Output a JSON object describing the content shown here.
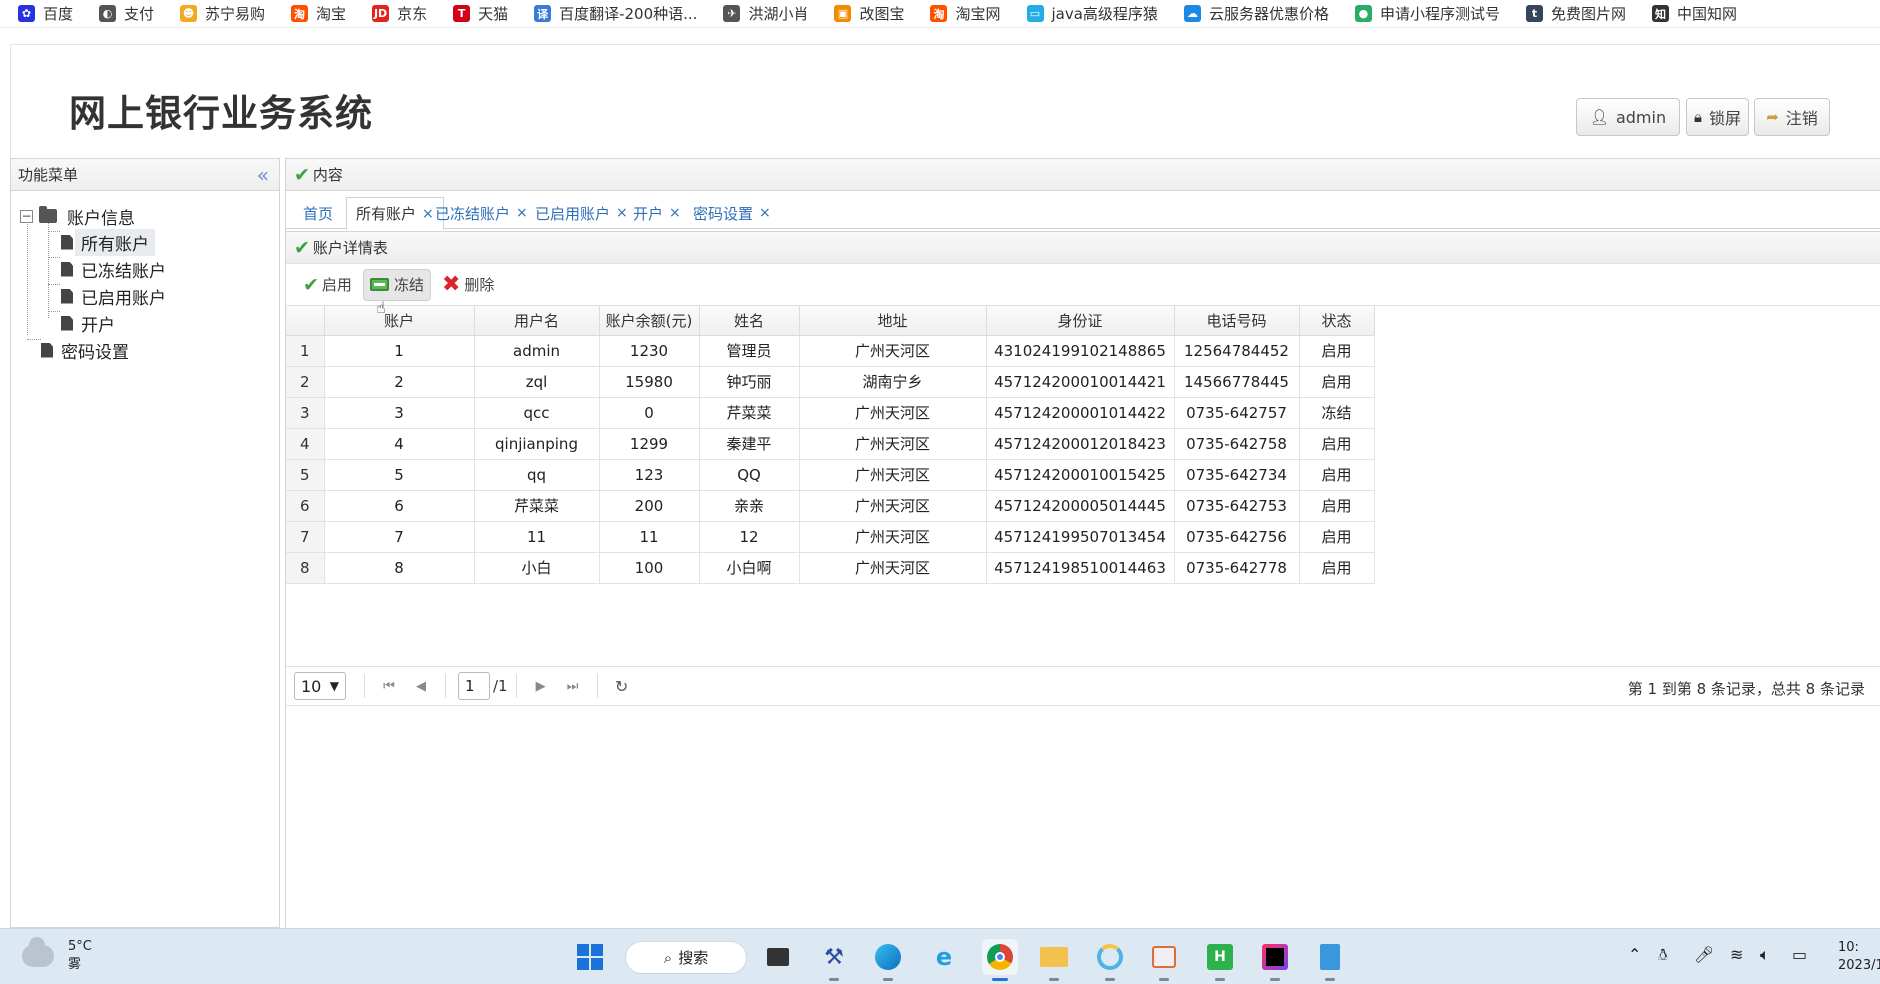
{
  "bookmarks": [
    {
      "label": "百度",
      "icon": "baidu-icon",
      "color": "#2932e1",
      "glyph": "✿"
    },
    {
      "label": "支付",
      "icon": "globe-icon",
      "color": "#555555",
      "glyph": "◐"
    },
    {
      "label": "苏宁易购",
      "icon": "suning-icon",
      "color": "#f5a623",
      "glyph": "☻"
    },
    {
      "label": "淘宝",
      "icon": "taobao-icon",
      "color": "#ff5000",
      "glyph": "淘"
    },
    {
      "label": "京东",
      "icon": "jd-icon",
      "color": "#e1251b",
      "glyph": "JD"
    },
    {
      "label": "天猫",
      "icon": "tmall-icon",
      "color": "#d4001a",
      "glyph": "T"
    },
    {
      "label": "百度翻译-200种语...",
      "icon": "translate-icon",
      "color": "#3a7bd5",
      "glyph": "译"
    },
    {
      "label": "洪湖小肖",
      "icon": "bird-icon",
      "color": "#555555",
      "glyph": "✈"
    },
    {
      "label": "改图宝",
      "icon": "gaitubao-icon",
      "color": "#f08c00",
      "glyph": "▣"
    },
    {
      "label": "淘宝网",
      "icon": "taobao2-icon",
      "color": "#ff5000",
      "glyph": "淘"
    },
    {
      "label": "java高级程序猿",
      "icon": "bilibili-icon",
      "color": "#23ade5",
      "glyph": "▭"
    },
    {
      "label": "云服务器优惠价格",
      "icon": "cloud-icon",
      "color": "#1e88e5",
      "glyph": "☁"
    },
    {
      "label": "申请小程序测试号",
      "icon": "wechat-icon",
      "color": "#2aae67",
      "glyph": "●"
    },
    {
      "label": "免费图片网",
      "icon": "tumblr-icon",
      "color": "#35465c",
      "glyph": "t"
    },
    {
      "label": "中国知网",
      "icon": "cnki-icon",
      "color": "#333333",
      "glyph": "知"
    }
  ],
  "header": {
    "title": "网上银行业务系统",
    "user_label": "admin",
    "lock_label": "锁屏",
    "logout_label": "注销"
  },
  "sidebar": {
    "title": "功能菜单",
    "collapse_glyph": "«",
    "root": {
      "label": "账户信息",
      "expander": "−"
    },
    "children": [
      "所有账户",
      "已冻结账户",
      "已启用账户",
      "开户"
    ],
    "extra": "密码设置"
  },
  "main": {
    "title": "内容",
    "tabs": [
      {
        "label": "首页",
        "closable": false
      },
      {
        "label": "所有账户",
        "closable": true
      },
      {
        "label": "已冻结账户",
        "closable": true
      },
      {
        "label": "已启用账户",
        "closable": true
      },
      {
        "label": "开户",
        "closable": true
      },
      {
        "label": "密码设置",
        "closable": true
      }
    ],
    "close_glyph": "×",
    "grid_title": "账户详情表",
    "toolbar": {
      "enable": "启用",
      "freeze": "冻结",
      "delete": "删除"
    },
    "columns": [
      "账户",
      "用户名",
      "账户余额(元)",
      "姓名",
      "地址",
      "身份证",
      "电话号码",
      "状态"
    ],
    "rows": [
      [
        "1",
        "1",
        "admin",
        "1230",
        "管理员",
        "广州天河区",
        "431024199102148865",
        "12564784452",
        "启用"
      ],
      [
        "2",
        "2",
        "zql",
        "15980",
        "钟巧丽",
        "湖南宁乡",
        "457124200010014421",
        "14566778445",
        "启用"
      ],
      [
        "3",
        "3",
        "qcc",
        "0",
        "芹菜菜",
        "广州天河区",
        "457124200001014422",
        "0735-642757",
        "冻结"
      ],
      [
        "4",
        "4",
        "qinjianping",
        "1299",
        "秦建平",
        "广州天河区",
        "457124200012018423",
        "0735-642758",
        "启用"
      ],
      [
        "5",
        "5",
        "qq",
        "123",
        "QQ",
        "广州天河区",
        "457124200010015425",
        "0735-642734",
        "启用"
      ],
      [
        "6",
        "6",
        "芹菜菜",
        "200",
        "亲亲",
        "广州天河区",
        "457124200005014445",
        "0735-642753",
        "启用"
      ],
      [
        "7",
        "7",
        "11",
        "11",
        "12",
        "广州天河区",
        "457124199507013454",
        "0735-642756",
        "启用"
      ],
      [
        "8",
        "8",
        "小白",
        "100",
        "小白啊",
        "广州天河区",
        "457124198510014463",
        "0735-642778",
        "启用"
      ]
    ],
    "pager": {
      "page_size": "10",
      "page": "1",
      "total_pages": "/1",
      "info": "第 1 到第 8 条记录，总共 8 条记录"
    }
  },
  "taskbar": {
    "temp": "5°C",
    "condition": "雾",
    "search_label": "搜索",
    "clock_time": "10:",
    "clock_date": "2023/1"
  },
  "colors": {
    "accent": "#2d6fb8",
    "enable_green": "#3ea33e",
    "delete_red": "#d9242c"
  }
}
